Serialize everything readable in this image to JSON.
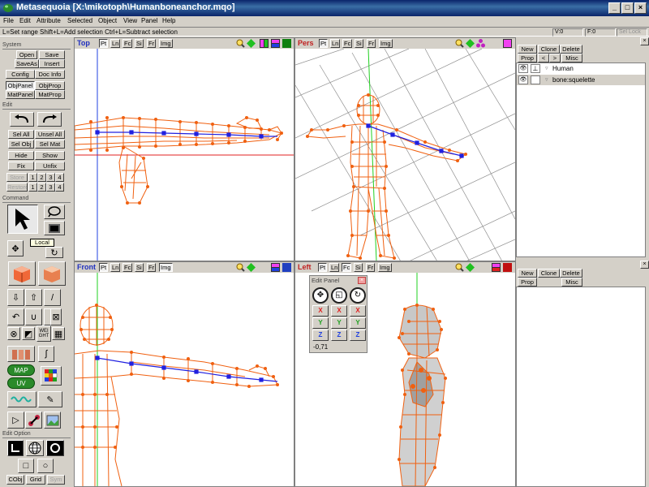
{
  "window": {
    "title": "Metasequoia [X:\\mikotoph\\Humanboneanchor.mqo]",
    "buttons": [
      "_",
      "□",
      "×"
    ]
  },
  "menu": [
    "File",
    "Edit",
    "Attribute",
    "Selected",
    "Object",
    "View",
    "Panel",
    "Help"
  ],
  "status": {
    "hint": "L=Set range  Shift+L=Add selection  Ctrl+L=Subtract selection",
    "v_count": "V:0",
    "f_count": "F:0",
    "sel_lock": "Sel Lock"
  },
  "left_panel": {
    "system": {
      "label": "System",
      "buttons": [
        "Open",
        "Save",
        "SaveAs",
        "Insert",
        "Config",
        "Doc Info",
        "ObjPanel",
        "ObjProp",
        "MatPanel",
        "MatProp"
      ]
    },
    "edit": {
      "label": "Edit",
      "buttons": [
        "Sel All",
        "Unsel All",
        "Sel Obj",
        "Sel Mat",
        "Hide",
        "Show",
        "Fix",
        "Unfix"
      ],
      "store_label": "Store",
      "restore_label": "Restore",
      "slots": [
        "1",
        "2",
        "3",
        "4"
      ]
    },
    "command": {
      "label": "Command",
      "tooltip": "Local",
      "map_label": "MAP",
      "uv_label": "UV",
      "weight_label": "WEI GHT"
    },
    "edit_option": {
      "label": "Edit Option",
      "buttons": [
        "CObj",
        "Grid",
        "Sym"
      ]
    }
  },
  "viewports": {
    "tabs": [
      "Pt",
      "Ln",
      "Fc",
      "Si",
      "Fr",
      "Img"
    ],
    "top": {
      "name": "Top"
    },
    "pers": {
      "name": "Pers"
    },
    "front": {
      "name": "Front"
    },
    "left": {
      "name": "Left"
    }
  },
  "object_panel": {
    "buttons": [
      "New",
      "Clone",
      "Delete"
    ],
    "buttons2": [
      "Prop",
      "<",
      ">",
      "Misc"
    ],
    "objects": [
      "Human",
      "bone:squelette"
    ]
  },
  "material_panel": {
    "buttons": [
      "New",
      "Clone",
      "Delete"
    ],
    "buttons2": [
      "Prop",
      "Misc"
    ]
  },
  "edit_panel": {
    "title": "Edit Panel",
    "axes": [
      "X",
      "Y",
      "Z"
    ],
    "value": "-0,71"
  },
  "colors": {
    "titlebar": "#0a246a",
    "mesh": "#f06010",
    "bone": "#2020e0",
    "axis_red": "#e02020",
    "axis_green": "#20d020",
    "axis_blue": "#2040e0"
  }
}
